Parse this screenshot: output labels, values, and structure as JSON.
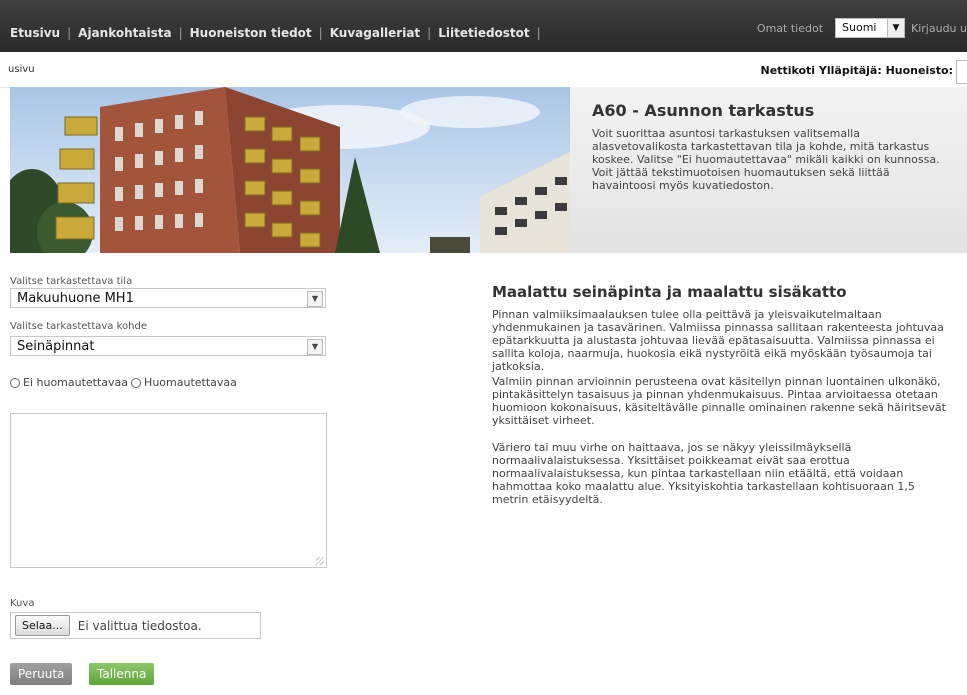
{
  "nav": {
    "items": [
      "Etusivu",
      "Ajankohtaista",
      "Huoneiston tiedot",
      "Kuvagalleriat",
      "Liitetiedostot"
    ],
    "my_info": "Omat tiedot",
    "language": "Suomi",
    "login": "Kirjaudu u"
  },
  "breadcrumb": "usivu",
  "admin_line": "Nettikoti Ylläpitäjä: Huoneisto:",
  "hero": {
    "title": "A60 - Asunnon tarkastus",
    "description": "Voit suorittaa asuntosi tarkastuksen valitsemalla alasvetovalikosta tarkastettavan tila ja kohde, mitä tarkastus koskee. Valitse \"Ei huomautettavaa\" mikäli kaikki on kunnossa. Voit jättää tekstimuotoisen huomautuksen sekä liittää havaintoosi myös kuvatiedoston."
  },
  "form": {
    "room_label": "Valitse tarkastettava tila",
    "room_value": "Makuuhuone MH1",
    "target_label": "Valitse tarkastettava kohde",
    "target_value": "Seinäpinnat",
    "radio_no_remarks": "Ei huomautettavaa",
    "radio_remarks": "Huomautettavaa",
    "image_label": "Kuva",
    "browse_label": "Selaa...",
    "no_file_text": "Ei valittua tiedostoa.",
    "cancel_label": "Peruuta",
    "save_label": "Tallenna"
  },
  "content": {
    "title": "Maalattu seinäpinta ja maalattu sisäkatto",
    "paragraphs": [
      "Pinnan valmiiksimaalauksen tulee olla peittävä ja yleisvaikutelmaltaan yhdenmukainen ja tasavärinen. Valmiissa pinnassa sallitaan rakenteesta johtuvaa epätarkkuutta ja alustasta johtuvaa lievää epätasaisuutta. Valmiissa pinnassa ei sallita koloja, naarmuja, huokosia eikä nystyröitä eikä myöskään työsaumoja tai jatkoksia.",
      "Valmiin pinnan arvioinnin perusteena ovat käsitellyn pinnan luontainen ulkonäkö, pintakäsittelyn tasaisuus ja pinnan yhdenmukaisuus. Pintaa arvioitaessa otetaan huomioon kokonaisuus, käsiteltävälle pinnalle ominainen rakenne sekä häiritsevät yksittäiset virheet.",
      "Väriero tai muu virhe on haittaava, jos se näkyy yleissilmäyksellä normaalivalaistuksessa. Yksittäiset poikkeamat eivät saa erottua normaalivalaistuksessa, kun pintaa tarkastellaan niin etäältä, että voidaan hahmottaa koko maalattu alue. Yksityiskohtia tarkastellaan kohtisuoraan 1,5 metrin etäisyydeltä."
    ]
  }
}
